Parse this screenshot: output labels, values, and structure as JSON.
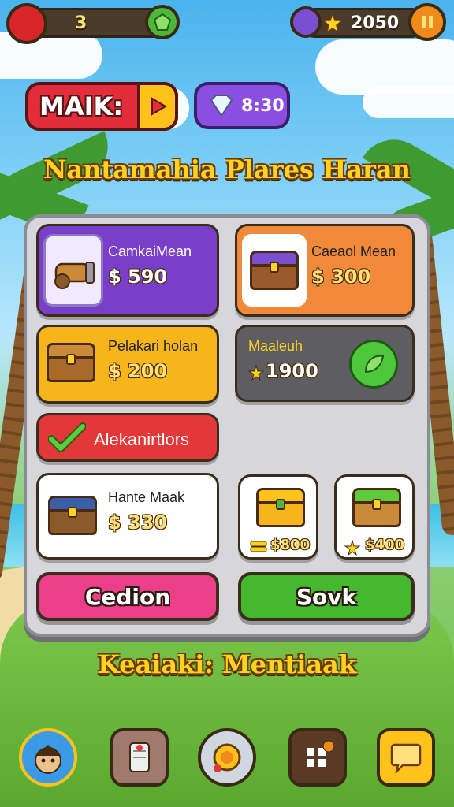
{
  "hud": {
    "gems_value": "3",
    "stars_value": "2050"
  },
  "banner": {
    "left_label": "MAIK:",
    "right_value": "8:30"
  },
  "title": "Nantamahia Plares Haran",
  "shop": {
    "items": [
      {
        "name": "CamkaiMean",
        "price": "$ 590",
        "color": "#7a3fc8",
        "thumb_color": "#f1eaff"
      },
      {
        "name": "Caeaol Mean",
        "price": "$ 300",
        "color": "#f08a3a",
        "thumb_color": "#ffffff"
      },
      {
        "name": "Pelakari holan",
        "price": "$ 200",
        "color": "#f6b51a",
        "thumb_color": "#f6b51a"
      },
      {
        "name": "Maaleuh",
        "price": "1900",
        "color": "#5e5e62",
        "thumb_color": "#5e5e62"
      },
      {
        "name": "Alekanirtlors",
        "price": "",
        "color": "#e3383a",
        "thumb_color": "#e3383a"
      },
      {
        "name": "Hante Maak",
        "price": "$ 330",
        "color": "#ffffff",
        "thumb_color": "#ffffff"
      },
      {
        "name": "",
        "price": "$800",
        "color": "#ffffff",
        "thumb_color": "#ffffff"
      },
      {
        "name": "",
        "price": "$400",
        "color": "#ffffff",
        "thumb_color": "#ffffff"
      }
    ],
    "cancel_label": "Cedion",
    "confirm_label": "Sovk"
  },
  "footer_title": "Keaiaki: Mentiaak",
  "colors": {
    "cancel": "#ec3f8a",
    "confirm": "#45b82d",
    "gold": "#ffd21f"
  }
}
